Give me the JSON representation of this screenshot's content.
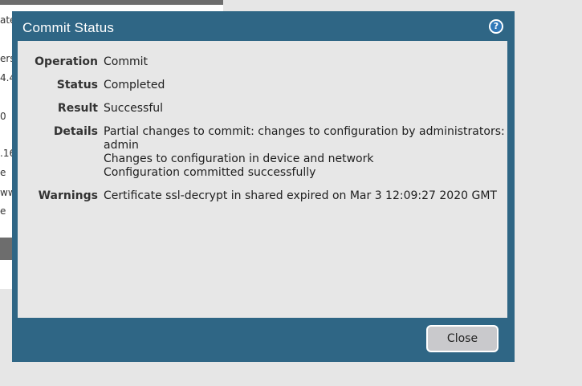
{
  "background": {
    "fragments": [
      "ate",
      "ers",
      "4.4",
      "0",
      ".16",
      "e",
      "ww",
      "e"
    ]
  },
  "dialog": {
    "title": "Commit Status",
    "help_icon": "help-circle-icon",
    "help_glyph": "?",
    "rows": [
      {
        "label": "Operation",
        "lines": [
          "Commit"
        ]
      },
      {
        "label": "Status",
        "lines": [
          "Completed"
        ]
      },
      {
        "label": "Result",
        "lines": [
          "Successful"
        ]
      },
      {
        "label": "Details",
        "lines": [
          "Partial changes to commit: changes to configuration by administrators: admin",
          "Changes to configuration in device and network",
          "Configuration committed successfully"
        ]
      },
      {
        "label": "Warnings",
        "lines": [
          "Certificate ssl-decrypt in shared expired on Mar 3 12:09:27 2020 GMT"
        ]
      }
    ],
    "close_label": "Close"
  },
  "colors": {
    "dialog_frame": "#2f6685",
    "body": "#e7e7e7",
    "help": "#2f78b8"
  }
}
